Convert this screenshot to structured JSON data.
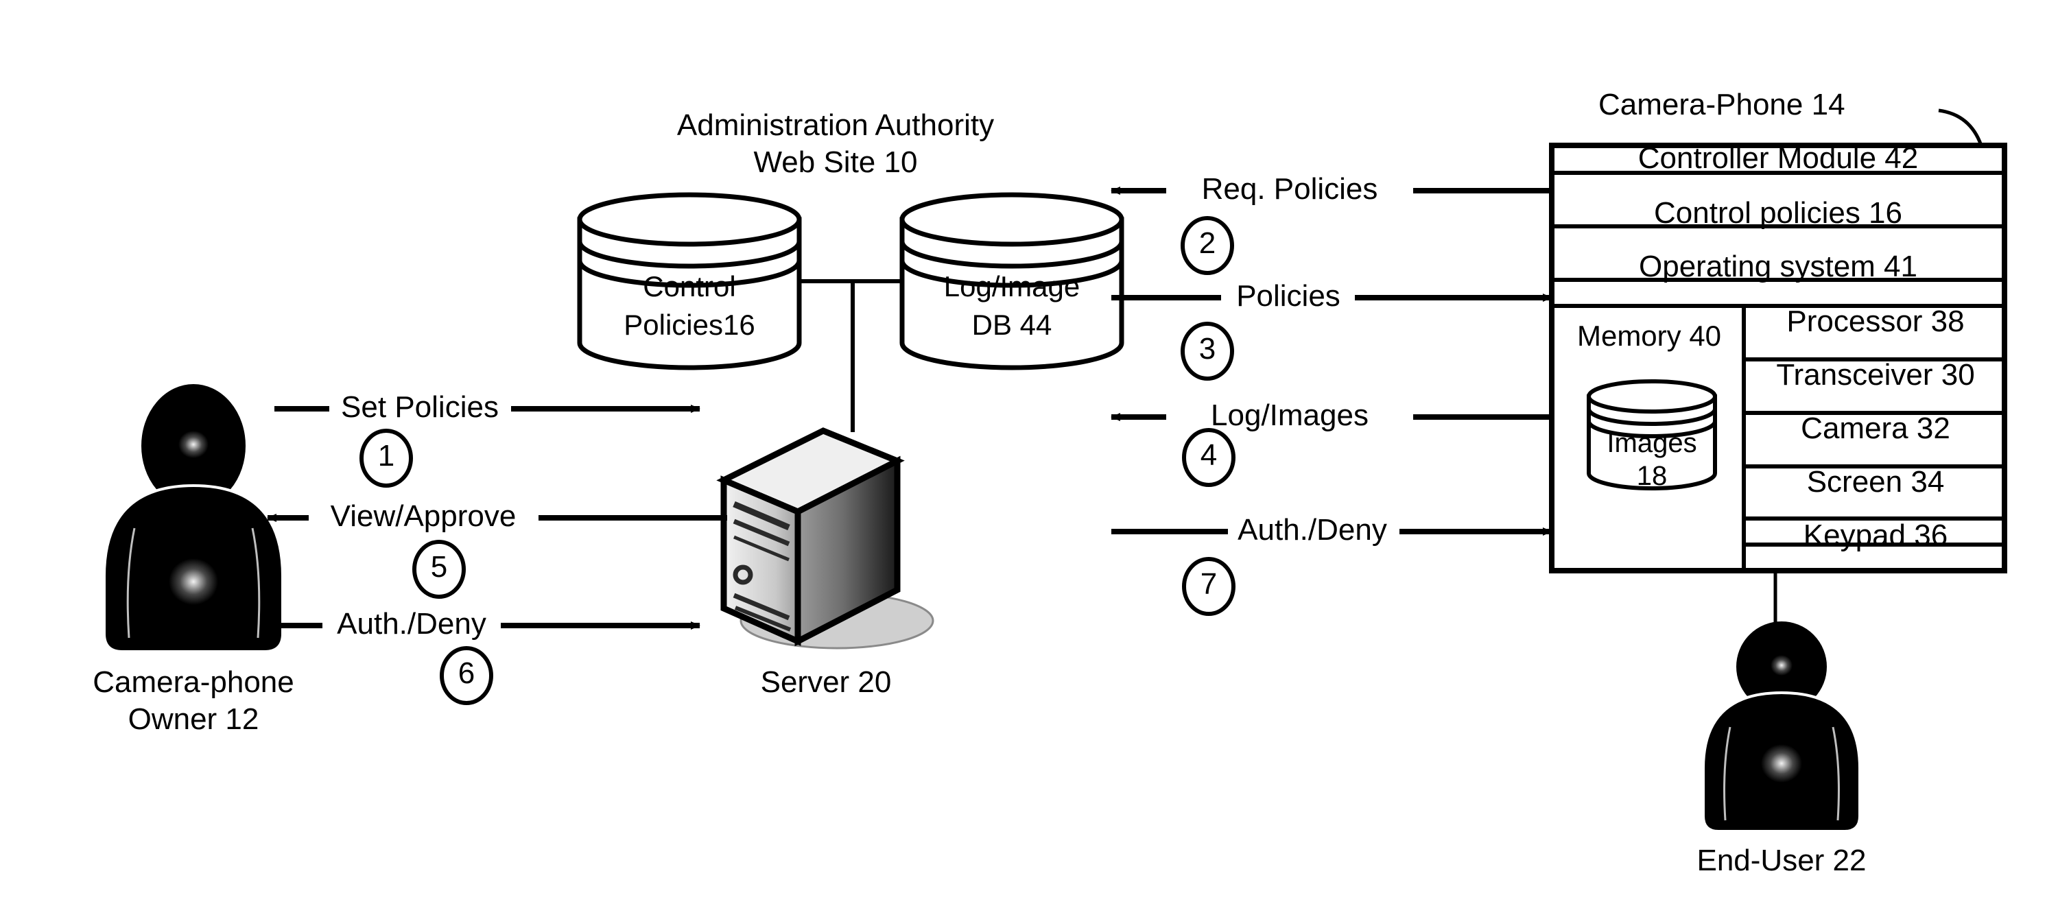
{
  "figure": {
    "title_adminsite": "Administration Authority\nWeb Site 10",
    "title_adminsite_line1": "Administration Authority",
    "title_adminsite_line2": "Web Site 10",
    "camera_phone_label": "Camera-Phone 14",
    "server_label": "Server 20",
    "owner_label_line1": "Camera-phone",
    "owner_label_line2": "Owner 12",
    "end_user_label": "End-User 22"
  },
  "databases": [
    {
      "name": "control-policies-db",
      "line1": "Control",
      "line2": "Policies16"
    },
    {
      "name": "log-image-db",
      "line1": "Log/Image",
      "line2": "DB 44"
    }
  ],
  "phone_stack": {
    "full_rows": [
      {
        "name": "controller-module",
        "label": "Controller Module 42"
      },
      {
        "name": "control-policies",
        "label": "Control policies 16"
      },
      {
        "name": "operating-system",
        "label": "Operating system 41"
      }
    ],
    "memory": {
      "label": "Memory 40",
      "cylinder_line1": "Images",
      "cylinder_line2": "18"
    },
    "components": [
      {
        "name": "processor",
        "label": "Processor 38"
      },
      {
        "name": "transceiver",
        "label": "Transceiver 30"
      },
      {
        "name": "camera",
        "label": "Camera 32"
      },
      {
        "name": "screen",
        "label": "Screen 34"
      },
      {
        "name": "keypad",
        "label": "Keypad 36"
      }
    ]
  },
  "flows_left": [
    {
      "name": "set-policies",
      "label": "Set Policies",
      "step": "1",
      "direction": "right"
    },
    {
      "name": "view-approve",
      "label": "View/Approve",
      "step": "5",
      "direction": "left"
    },
    {
      "name": "auth-deny-owner",
      "label": "Auth./Deny",
      "step": "6",
      "direction": "right"
    }
  ],
  "flows_right": [
    {
      "name": "req-policies",
      "label": "Req. Policies",
      "step": "2",
      "direction": "left"
    },
    {
      "name": "policies",
      "label": "Policies",
      "step": "3",
      "direction": "right"
    },
    {
      "name": "log-images",
      "label": "Log/Images",
      "step": "4",
      "direction": "left"
    },
    {
      "name": "auth-deny-phone",
      "label": "Auth./Deny",
      "step": "7",
      "direction": "right"
    }
  ],
  "colors": {
    "ink": "#000000",
    "paper": "#ffffff"
  }
}
